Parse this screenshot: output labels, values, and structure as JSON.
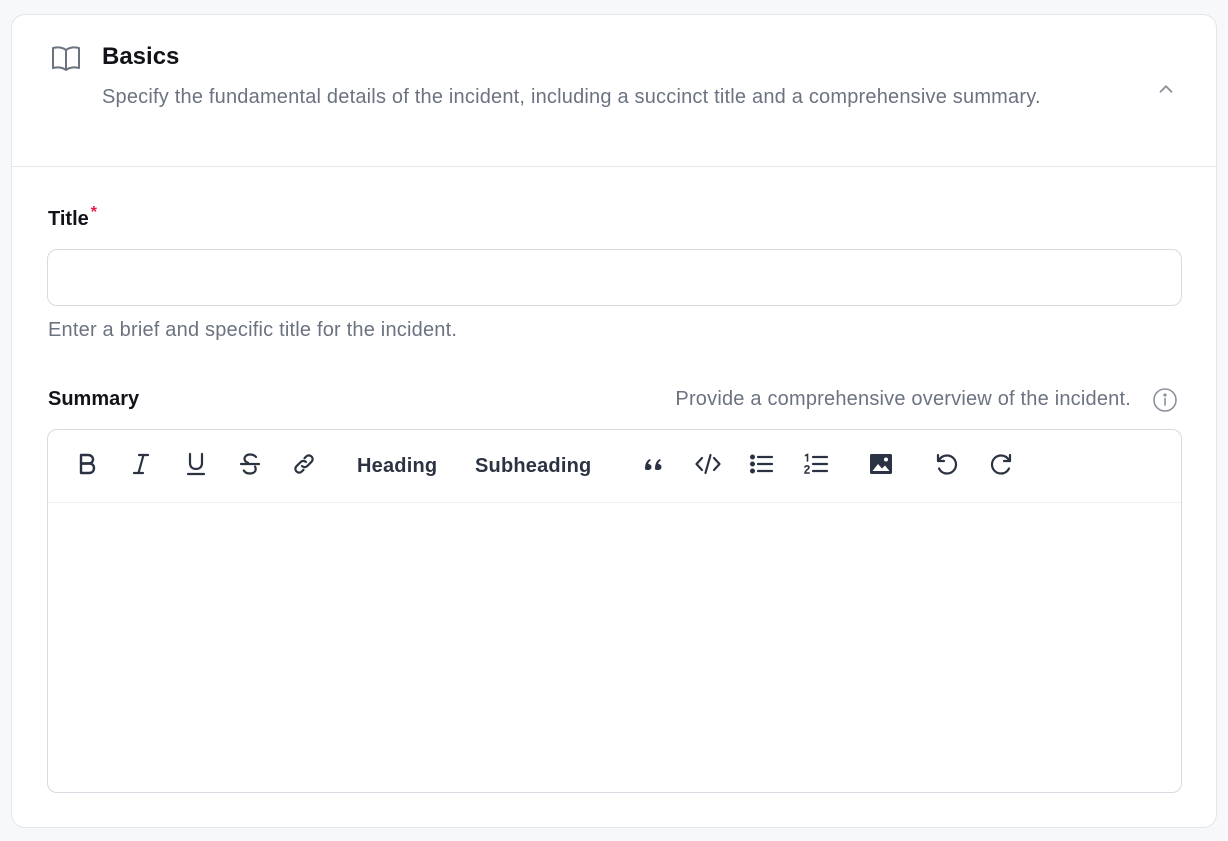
{
  "section": {
    "title": "Basics",
    "description": "Specify the fundamental details of the incident, including a succinct title and a comprehensive summary.",
    "icon": "book-open-icon",
    "collapse_icon": "chevron-up-icon"
  },
  "fields": {
    "title": {
      "label": "Title",
      "required_mark": "*",
      "value": "",
      "placeholder": "",
      "help": "Enter a brief and specific title for the incident."
    },
    "summary": {
      "label": "Summary",
      "help": "Provide a comprehensive overview of the incident.",
      "info_icon": "info-icon",
      "content": ""
    }
  },
  "toolbar": {
    "heading_label": "Heading",
    "subheading_label": "Subheading",
    "icons": [
      "bold-icon",
      "italic-icon",
      "underline-icon",
      "strikethrough-icon",
      "link-icon",
      "blockquote-icon",
      "code-icon",
      "bullet-list-icon",
      "numbered-list-icon",
      "image-icon",
      "undo-icon",
      "redo-icon"
    ]
  },
  "colors": {
    "required": "#e11d48",
    "muted_text": "#6b7280",
    "border": "#d7dae0",
    "icon": "#2b3342"
  }
}
